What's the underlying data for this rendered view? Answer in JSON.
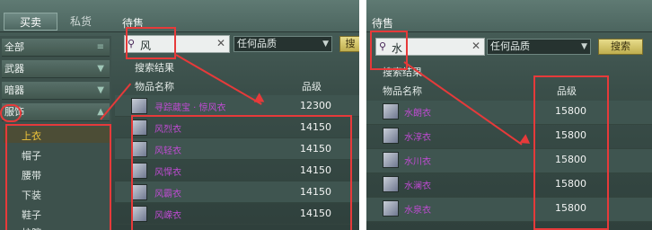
{
  "left": {
    "tabs": [
      "买卖",
      "私货"
    ],
    "section_label": "待售",
    "categories": [
      {
        "label": "全部",
        "icon": "≡"
      },
      {
        "label": "武器",
        "icon": "▼"
      },
      {
        "label": "暗器",
        "icon": "▼"
      },
      {
        "label": "服饰",
        "icon": "▲"
      }
    ],
    "subcategories": [
      "上衣",
      "帽子",
      "腰带",
      "下装",
      "鞋子",
      "护腕"
    ],
    "search": {
      "query": "风",
      "quality": "任何品质",
      "button": "搜"
    },
    "results_title": "搜索结果",
    "columns": {
      "name": "物品名称",
      "grade": "品级"
    },
    "rows": [
      {
        "name": "寻踪葳宝 · 惊风衣",
        "grade": "12300"
      },
      {
        "name": "风烈衣",
        "grade": "14150"
      },
      {
        "name": "风轻衣",
        "grade": "14150"
      },
      {
        "name": "风悍衣",
        "grade": "14150"
      },
      {
        "name": "风霸衣",
        "grade": "14150"
      },
      {
        "name": "风嵘衣",
        "grade": "14150"
      }
    ]
  },
  "right": {
    "section_label": "待售",
    "search": {
      "query": "水",
      "quality": "任何品质",
      "button": "搜索"
    },
    "results_title": "搜索结果",
    "columns": {
      "name": "物品名称",
      "grade": "品级"
    },
    "rows": [
      {
        "name": "水朗衣",
        "grade": "15800"
      },
      {
        "name": "水淳衣",
        "grade": "15800"
      },
      {
        "name": "水川衣",
        "grade": "15800"
      },
      {
        "name": "水澜衣",
        "grade": "15800"
      },
      {
        "name": "水泉衣",
        "grade": "15800"
      }
    ]
  },
  "colors": {
    "highlight": "#e63a3a",
    "item_name": "#c04bd3",
    "active_sub": "#f0c43a"
  }
}
